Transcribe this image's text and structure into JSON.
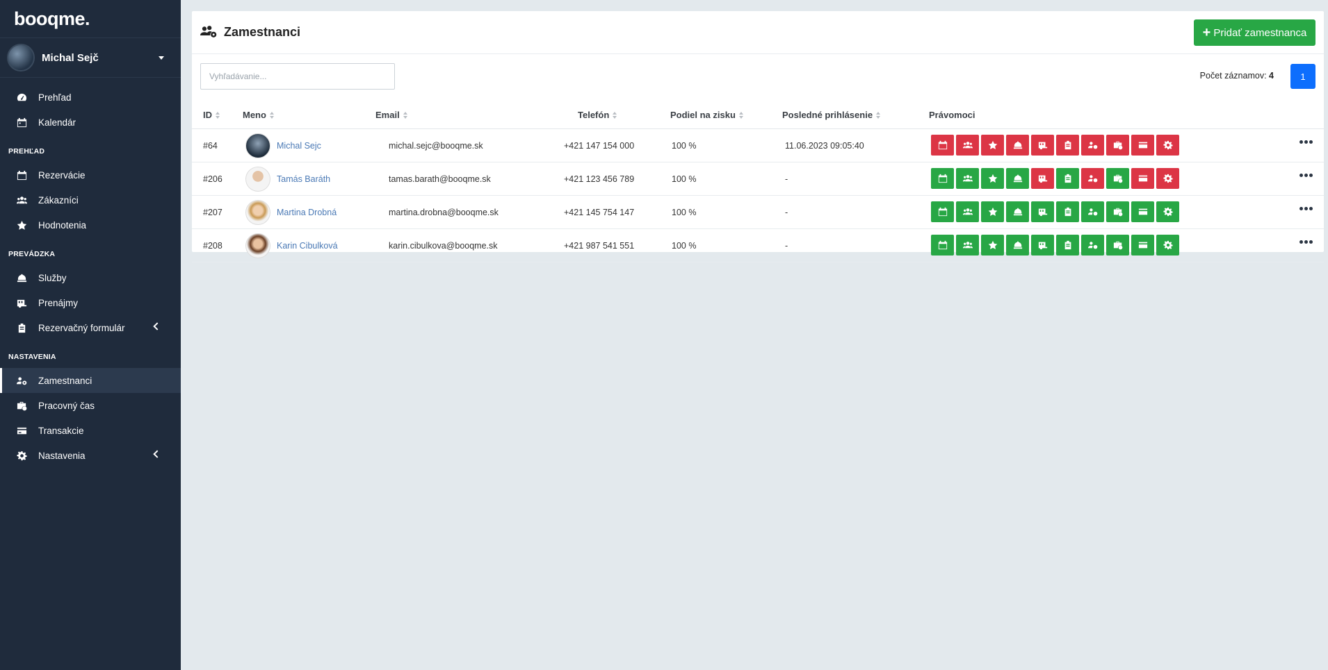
{
  "brand": "booqme.",
  "user": {
    "name": "Michal Sejč"
  },
  "nav": {
    "top": [
      {
        "label": "Prehľad",
        "icon": "gauge-icon"
      },
      {
        "label": "Kalendár",
        "icon": "calendar-icon"
      }
    ],
    "sections": [
      {
        "title": "PREHĽAD",
        "items": [
          {
            "label": "Rezervácie",
            "icon": "calendar-icon"
          },
          {
            "label": "Zákazníci",
            "icon": "users-icon"
          },
          {
            "label": "Hodnotenia",
            "icon": "star-icon"
          }
        ]
      },
      {
        "title": "PREVÁDZKA",
        "items": [
          {
            "label": "Služby",
            "icon": "bell-icon"
          },
          {
            "label": "Prenájmy",
            "icon": "trailer-icon"
          },
          {
            "label": "Rezervačný formulár",
            "icon": "clipboard-icon"
          }
        ]
      },
      {
        "title": "NASTAVENIA",
        "items": [
          {
            "label": "Zamestnanci",
            "icon": "users-cog-icon"
          },
          {
            "label": "Pracovný čas",
            "icon": "business-time-icon"
          },
          {
            "label": "Transakcie",
            "icon": "credit-card-icon"
          },
          {
            "label": "Nastavenia",
            "icon": "gear-icon"
          }
        ]
      }
    ]
  },
  "page": {
    "title": "Zamestnanci",
    "add_button": "Pridať zamestnanca",
    "search_placeholder": "Vyhľadávanie...",
    "count_label": "Počet záznamov:",
    "count_value": "4",
    "current_page": "1"
  },
  "table": {
    "headers": [
      "ID",
      "Meno",
      "Email",
      "Telefón",
      "Podiel na zisku",
      "Posledné prihlásenie",
      "Právomoci"
    ],
    "rows": [
      {
        "id": "#64",
        "name": "Michal Sejc",
        "email": "michal.sejc@booqme.sk",
        "phone": "+421 147 154 000",
        "share": "100 %",
        "last_login": "11.06.2023 09:05:40",
        "perms": [
          false,
          false,
          false,
          false,
          false,
          false,
          false,
          false,
          false,
          false
        ]
      },
      {
        "id": "#206",
        "name": "Tamás Baráth",
        "email": "tamas.barath@booqme.sk",
        "phone": "+421 123 456 789",
        "share": "100 %",
        "last_login": "-",
        "perms": [
          true,
          true,
          true,
          true,
          false,
          true,
          false,
          true,
          false,
          false
        ]
      },
      {
        "id": "#207",
        "name": "Martina Drobná",
        "email": "martina.drobna@booqme.sk",
        "phone": "+421 145 754 147",
        "share": "100 %",
        "last_login": "-",
        "perms": [
          true,
          true,
          true,
          true,
          true,
          true,
          true,
          true,
          true,
          true
        ]
      },
      {
        "id": "#208",
        "name": "Karin Cibulková",
        "email": "karin.cibulkova@booqme.sk",
        "phone": "+421 987 541 551",
        "share": "100 %",
        "last_login": "-",
        "perms": [
          true,
          true,
          true,
          true,
          true,
          true,
          true,
          true,
          true,
          true
        ]
      }
    ]
  },
  "perm_icons": [
    "calendar-icon",
    "users-icon",
    "star-icon",
    "bell-icon",
    "trailer-icon",
    "clipboard-icon",
    "users-cog-icon",
    "business-time-icon",
    "credit-card-icon",
    "gear-icon"
  ],
  "colors": {
    "sidebar": "#1f2b3c",
    "granted": "#28a745",
    "denied": "#dc3545",
    "primary": "#0d6efd",
    "link": "#4a79b5"
  }
}
